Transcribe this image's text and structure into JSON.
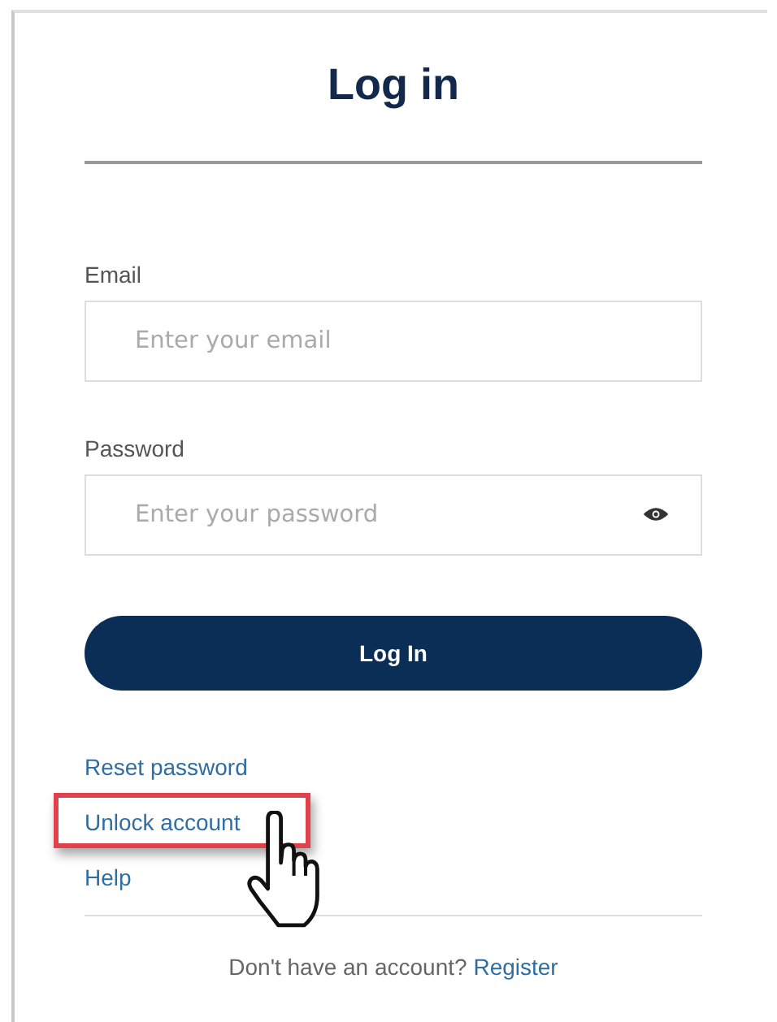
{
  "title": "Log in",
  "fields": [
    {
      "label": "Email",
      "placeholder": "Enter your email",
      "kind": "text"
    },
    {
      "label": "Password",
      "placeholder": "Enter your password",
      "kind": "password"
    }
  ],
  "submit": {
    "label": "Log In"
  },
  "links": [
    {
      "label": "Reset password",
      "highlighted": false
    },
    {
      "label": "Unlock account",
      "highlighted": true
    },
    {
      "label": "Help",
      "highlighted": false
    }
  ],
  "footer": {
    "text": "Don't have an account?",
    "link": "Register"
  }
}
